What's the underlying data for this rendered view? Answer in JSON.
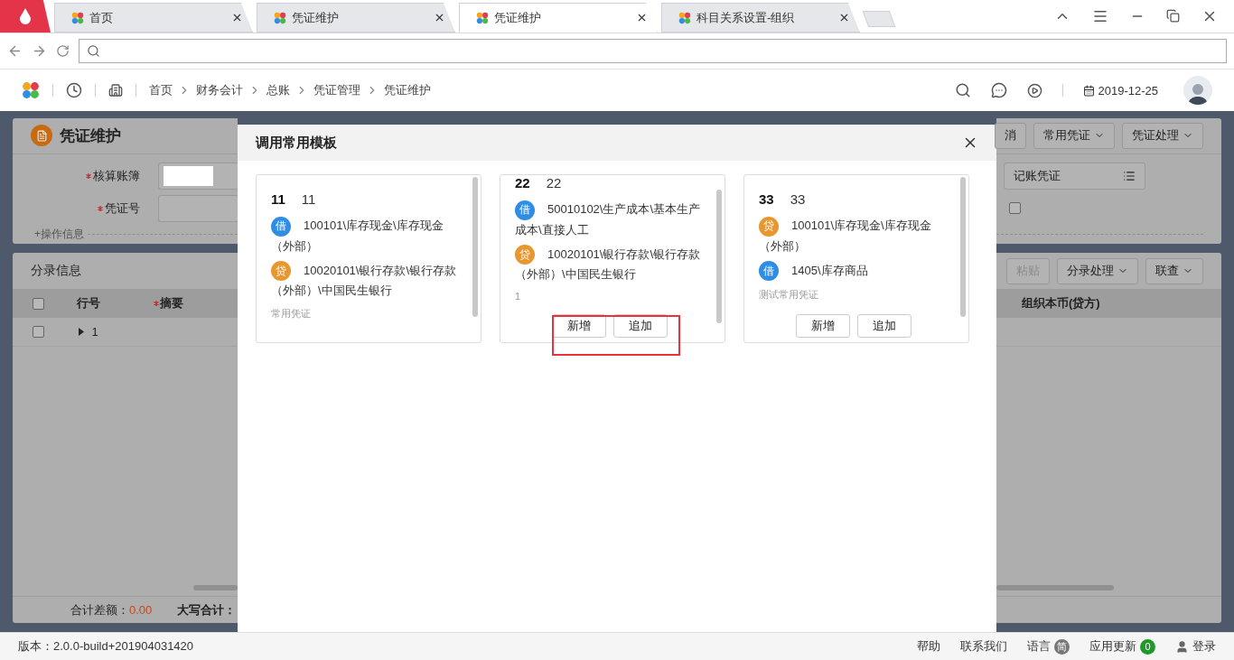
{
  "browser": {
    "tabs": [
      {
        "label": "首页",
        "selected": false
      },
      {
        "label": "凭证维护",
        "selected": false
      },
      {
        "label": "凭证维护",
        "selected": true
      },
      {
        "label": "科目关系设置-组织",
        "selected": false
      }
    ]
  },
  "app_header": {
    "breadcrumb": [
      "首页",
      "财务会计",
      "总账",
      "凭证管理",
      "凭证维护"
    ],
    "date": "2019-12-25"
  },
  "page": {
    "title": "凭证维护",
    "form": [
      {
        "label": "核算账簿",
        "required": true
      },
      {
        "label": "凭证号",
        "required": true
      }
    ],
    "operation_info": "+操作信息",
    "toolbar_buttons": [
      {
        "label": "消",
        "dropdown": false
      },
      {
        "label": "常用凭证",
        "dropdown": true
      },
      {
        "label": "凭证处理",
        "dropdown": true
      }
    ],
    "voucher_type": "记账凭证",
    "option_checked": false,
    "entries": {
      "title": "分录信息",
      "buttons": [
        {
          "label": "粘贴",
          "dropdown": false,
          "disabled": true
        },
        {
          "label": "分录处理",
          "dropdown": true,
          "disabled": false
        },
        {
          "label": "联查",
          "dropdown": true,
          "disabled": false
        }
      ],
      "columns_left": [
        {
          "label": "行号",
          "required": false
        },
        {
          "label": "摘要",
          "required": true
        }
      ],
      "columns_right": [
        {
          "label": "组织本币(贷方)",
          "required": false
        }
      ],
      "all_checked": false,
      "rows": [
        {
          "number": "1",
          "checked": false
        }
      ]
    },
    "totals": {
      "difference_label": "合计差额：",
      "difference": "0.00",
      "uppercase_label": "大写合计："
    }
  },
  "modal": {
    "title": "调用常用模板",
    "cards": [
      {
        "code": "11",
        "name": "11",
        "scrolled": false,
        "highlighted": false,
        "entries": [
          {
            "kind": "debit",
            "badge": "借",
            "account": "100101\\库存现金\\库存现金（外部）"
          },
          {
            "kind": "credit",
            "badge": "贷",
            "account": "10020101\\银行存款\\银行存款（外部）\\中国民生银行"
          }
        ],
        "note": "常用凭证"
      },
      {
        "code": "22",
        "name": "22",
        "scrolled": true,
        "highlighted": true,
        "entries": [
          {
            "kind": "debit",
            "badge": "借",
            "account": "50010102\\生产成本\\基本生产成本\\直接人工"
          },
          {
            "kind": "credit",
            "badge": "贷",
            "account": "10020101\\银行存款\\银行存款（外部）\\中国民生银行"
          }
        ],
        "note": "1",
        "buttons": [
          "新增",
          "追加"
        ]
      },
      {
        "code": "33",
        "name": "33",
        "scrolled": false,
        "highlighted": false,
        "entries": [
          {
            "kind": "credit",
            "badge": "贷",
            "account": "100101\\库存现金\\库存现金（外部）"
          },
          {
            "kind": "debit",
            "badge": "借",
            "account": "1405\\库存商品"
          }
        ],
        "note": "测试常用凭证",
        "buttons": [
          "新增",
          "追加"
        ]
      }
    ]
  },
  "footer": {
    "version": "版本：2.0.0-build+201904031420",
    "links": [
      "帮助",
      "联系我们"
    ],
    "language": {
      "label": "语言",
      "badge": "简"
    },
    "updates": {
      "label": "应用更新",
      "count": "0"
    },
    "login": "登录"
  }
}
